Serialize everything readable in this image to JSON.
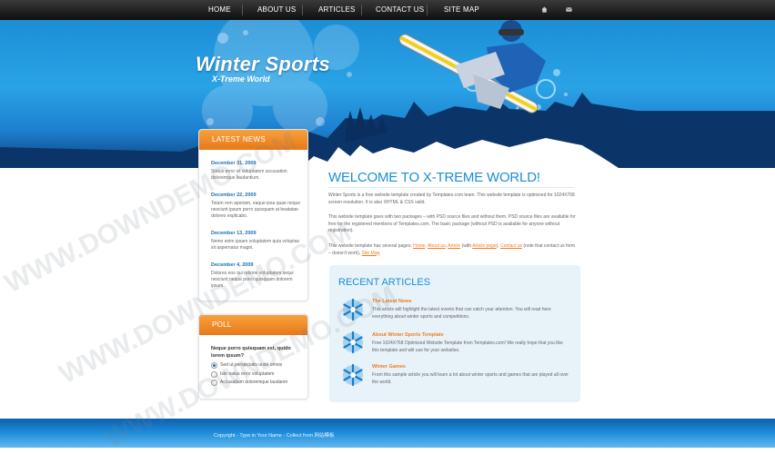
{
  "nav": {
    "items": [
      {
        "label": "HOME"
      },
      {
        "label": "ABOUT US"
      },
      {
        "label": "ARTICLES"
      },
      {
        "label": "CONTACT US"
      },
      {
        "label": "SITE MAP"
      }
    ],
    "icons": [
      "home-icon",
      "mail-icon"
    ]
  },
  "header": {
    "title": "Winter Sports",
    "subtitle": "X-Treme World"
  },
  "sidebar": {
    "news": {
      "title": "LATEST NEWS",
      "items": [
        {
          "date": "December 31, 2009",
          "text": "Status error sit voluptatem accusation doloremque laudantium."
        },
        {
          "date": "December 22, 2009",
          "text": "Totam rem aperiam, eaque ipsa quae neque nesciunt ipsum porro quisquam at beatatae dolores explicabo."
        },
        {
          "date": "December 13, 2009",
          "text": "Nemo enim ipsam voluptatem quia voluptas sit aspernatur magni."
        },
        {
          "date": "December 4, 2009",
          "text": "Dolores eos qui ratione voluptatem sequi nesciunt neque porro quisquam dolorem ipsum."
        }
      ]
    },
    "poll": {
      "title": "POLL",
      "question": "Neque porro quisquam est, quido lorem ipsum?",
      "options": [
        {
          "label": "Sed ut perspiciatis unde omnis",
          "selected": true
        },
        {
          "label": "Iste natus error voluptatem",
          "selected": false
        },
        {
          "label": "Accusatium doloremque laudanm",
          "selected": false
        }
      ]
    }
  },
  "main": {
    "welcome_title": "WELCOME TO X-TREME WORLD!",
    "para1": "Winter Sports is a free website template created by Templates.com team. This website template is optimized for 1024X768 screen resolution. It is also XHTML & CSS valid.",
    "para2": "This website template goes with two packages – with PSD source files and without them. PSD source files are available for free for the registered members of Templates.com. The basic package (without PSD is available for anyone without registration).",
    "para3": {
      "intro": "This website template has several pages:",
      "links": [
        "Home",
        "About us",
        "Article",
        "Article page",
        "Contact us",
        "Site Map"
      ],
      "with": "(with",
      "after_article_page": ")",
      "note": "(note that contact us form – doesn't work),",
      "end": "."
    },
    "recent": {
      "title": "RECENT ARTICLES",
      "articles": [
        {
          "title": "The Latest News",
          "text": "This article will highlight the latest events that can catch your attention. You will read here everything about winter sports and competitions."
        },
        {
          "title": "About Winter Sports Template",
          "text": "Free 1024X768 Optimized Website Template from Templates.com! We really hope that you like this template and will use for your websites."
        },
        {
          "title": "Winter Games",
          "text": "From this sample article you will learn a lot about winter sports and games that are played all over the world."
        }
      ]
    }
  },
  "footer": {
    "text": "Copyright - Type in Your Name - Collect from 网站模板"
  },
  "watermark": "WWW.DOWNDEMO.COM",
  "colors": {
    "accent_orange": "#ef7d1f",
    "title_blue": "#1a8fd6",
    "nav_bg": "#1a1a1a",
    "sky_blue": "#2aa3e6"
  }
}
